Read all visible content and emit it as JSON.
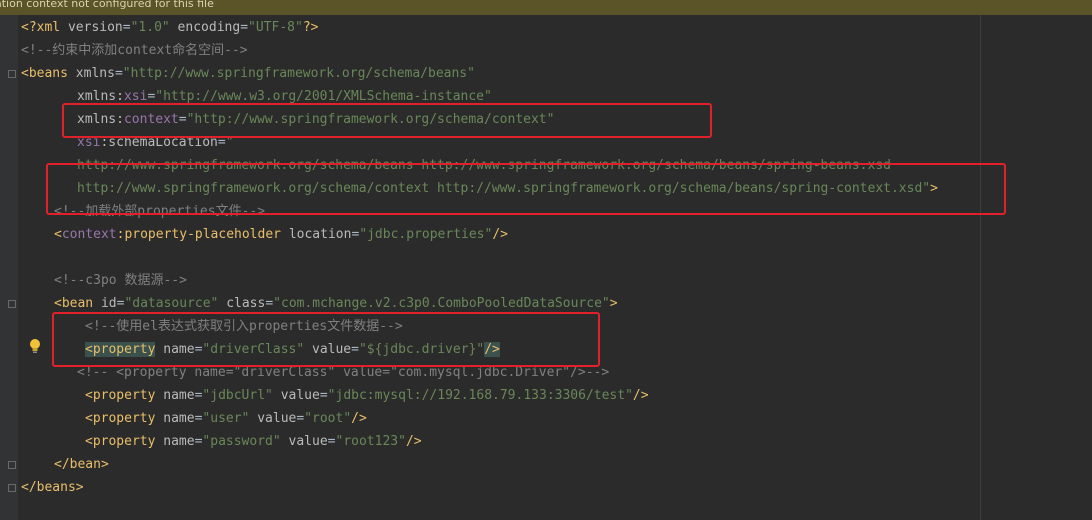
{
  "banner": {
    "text": "ation context not configured for this file"
  },
  "code": {
    "l1": {
      "pi_open": "<?xml",
      "a1": " version",
      "eq": "=",
      "v1": "\"1.0\"",
      "a2": " encoding",
      "v2": "\"UTF-8\"",
      "pi_close": "?>"
    },
    "l2": {
      "comment": "<!--约束中添加context命名空间-->"
    },
    "l3": {
      "open": "<beans",
      "attr": " xmlns",
      "eq": "=",
      "val": "\"http://www.springframework.org/schema/beans\""
    },
    "l4": {
      "attr": "xmlns:",
      "ns": "xsi",
      "eq": "=",
      "val": "\"http://www.w3.org/2001/XMLSchema-instance\""
    },
    "l5": {
      "attr": "xmlns:",
      "ns": "context",
      "eq": "=",
      "val": "\"http://www.springframework.org/schema/context\""
    },
    "l6": {
      "ns": "xsi",
      "attr": ":schemaLocation",
      "eq": "=",
      "val": "\""
    },
    "l7": {
      "val": "http://www.springframework.org/schema/beans http://www.springframework.org/schema/beans/spring-beans.xsd"
    },
    "l8": {
      "val": "http://www.springframework.org/schema/context http://www.springframework.org/schema/beans/spring-context.xsd\"",
      "close": ">"
    },
    "l9": {
      "comment": "<!--加载外部properties文件-->"
    },
    "l10": {
      "open": "<",
      "ns": "context",
      "tag": ":property-placeholder",
      "attr": " location",
      "eq": "=",
      "val": "\"jdbc.properties\"",
      "close": "/>"
    },
    "l12": {
      "comment": "<!--c3po 数据源-->"
    },
    "l13": {
      "open": "<bean",
      "a1": " id",
      "eq": "=",
      "v1": "\"datasource\"",
      "a2": " class",
      "v2": "\"com.mchange.v2.c3p0.ComboPooledDataSource\"",
      "close": ">"
    },
    "l14": {
      "comment": "<!--使用el表达式获取引入properties文件数据-->"
    },
    "l15": {
      "open": "<property",
      "a1": " name",
      "eq": "=",
      "v1": "\"driverClass\"",
      "a2": " value",
      "v2": "\"${jdbc.driver}\"",
      "close": "/>"
    },
    "l16": {
      "comment": "<!-- <property name=\"driverClass\" value=\"com.mysql.jdbc.Driver\"/>-->"
    },
    "l17": {
      "open": "<property",
      "a1": " name",
      "eq": "=",
      "v1": "\"jdbcUrl\"",
      "a2": " value",
      "v2": "\"jdbc:mysql://192.168.79.133:3306/test\"",
      "close": "/>"
    },
    "l18": {
      "open": "<property",
      "a1": " name",
      "eq": "=",
      "v1": "\"user\"",
      "a2": " value",
      "v2": "\"root\"",
      "close": "/>"
    },
    "l19": {
      "open": "<property",
      "a1": " name",
      "eq": "=",
      "v1": "\"password\"",
      "a2": " value",
      "v2": "\"root123\"",
      "close": "/>"
    },
    "l20": {
      "tag": "</bean>"
    },
    "l21": {
      "tag": "</beans>"
    }
  },
  "colors": {
    "background": "#2b2b2b",
    "tag": "#e8bf6a",
    "string": "#6a8759",
    "comment": "#808080",
    "namespace": "#9876aa",
    "annotation_box": "#e0202a",
    "warning_banner": "#5a5428"
  }
}
